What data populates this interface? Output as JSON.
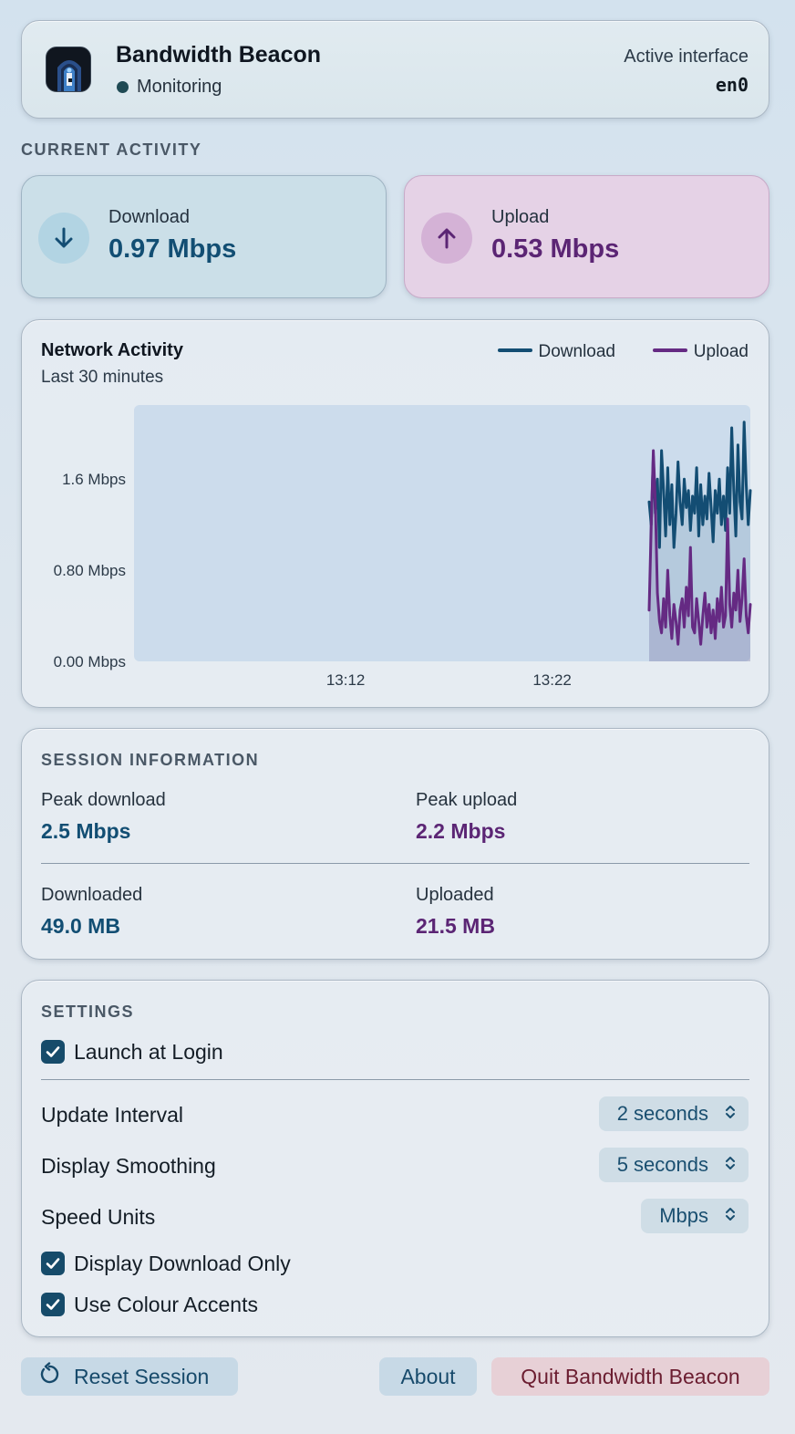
{
  "header": {
    "title": "Bandwidth Beacon",
    "status": "Monitoring",
    "interface_label": "Active interface",
    "interface_value": "en0"
  },
  "current_activity": {
    "caption": "CURRENT ACTIVITY",
    "download": {
      "label": "Download",
      "value": "0.97 Mbps",
      "icon": "arrow-down-icon"
    },
    "upload": {
      "label": "Upload",
      "value": "0.53 Mbps",
      "icon": "arrow-up-icon"
    }
  },
  "chart": {
    "title": "Network Activity",
    "subtitle": "Last 30 minutes",
    "legend": {
      "download": "Download",
      "upload": "Upload"
    }
  },
  "chart_data": {
    "type": "line",
    "title": "Network Activity",
    "subtitle": "Last 30 minutes",
    "xlabel": "",
    "ylabel": "",
    "y_ticks": [
      "0.00 Mbps",
      "0.80 Mbps",
      "1.6 Mbps"
    ],
    "y_tick_values": [
      0,
      0.8,
      1.6
    ],
    "ylim": [
      0,
      2.25
    ],
    "x_ticks": [
      "13:12",
      "13:22"
    ],
    "x_tick_minutes": [
      12,
      22
    ],
    "xlim_minutes": [
      1.75,
      31.6
    ],
    "x_unit": "minutes after 13:00",
    "grid": false,
    "legend_position": "top-right",
    "series": [
      {
        "name": "Download",
        "color": "#134d73",
        "x": [
          26.7,
          26.8,
          26.9,
          27.0,
          27.1,
          27.2,
          27.3,
          27.4,
          27.5,
          27.6,
          27.7,
          27.8,
          27.9,
          28.0,
          28.1,
          28.2,
          28.3,
          28.4,
          28.5,
          28.6,
          28.7,
          28.8,
          28.9,
          29.0,
          29.1,
          29.2,
          29.3,
          29.4,
          29.5,
          29.6,
          29.7,
          29.8,
          29.9,
          30.0,
          30.1,
          30.2,
          30.3,
          30.4,
          30.5,
          30.6,
          30.7,
          30.8,
          30.9,
          31.0,
          31.1,
          31.2,
          31.3,
          31.4,
          31.5,
          31.6
        ],
        "y": [
          1.4,
          1.2,
          1.8,
          1.3,
          1.6,
          1.0,
          1.85,
          1.5,
          1.1,
          1.7,
          1.2,
          1.55,
          1.0,
          1.3,
          1.75,
          1.4,
          1.2,
          1.6,
          1.35,
          1.5,
          1.15,
          1.45,
          1.3,
          1.7,
          1.1,
          1.55,
          1.2,
          1.45,
          1.25,
          1.65,
          1.35,
          1.05,
          1.5,
          1.3,
          1.6,
          1.2,
          1.45,
          1.15,
          1.7,
          1.3,
          2.05,
          1.5,
          1.1,
          1.9,
          1.4,
          1.25,
          2.1,
          1.55,
          1.2,
          1.5
        ]
      },
      {
        "name": "Upload",
        "color": "#652a83",
        "x": [
          26.7,
          26.8,
          26.9,
          27.0,
          27.1,
          27.2,
          27.3,
          27.4,
          27.5,
          27.6,
          27.7,
          27.8,
          27.9,
          28.0,
          28.1,
          28.2,
          28.3,
          28.4,
          28.5,
          28.6,
          28.7,
          28.8,
          28.9,
          29.0,
          29.1,
          29.2,
          29.3,
          29.4,
          29.5,
          29.6,
          29.7,
          29.8,
          29.9,
          30.0,
          30.1,
          30.2,
          30.3,
          30.4,
          30.5,
          30.6,
          30.7,
          30.8,
          30.9,
          31.0,
          31.1,
          31.2,
          31.3,
          31.4,
          31.5,
          31.6
        ],
        "y": [
          0.45,
          1.2,
          1.85,
          1.4,
          0.6,
          0.35,
          0.25,
          0.55,
          0.3,
          0.8,
          0.4,
          0.2,
          0.5,
          0.35,
          0.15,
          0.45,
          0.55,
          0.3,
          0.65,
          0.4,
          1.0,
          0.3,
          0.25,
          0.55,
          0.35,
          0.15,
          0.4,
          0.6,
          0.3,
          0.5,
          0.25,
          0.45,
          0.2,
          0.55,
          0.35,
          0.65,
          0.3,
          0.4,
          1.25,
          0.5,
          0.3,
          0.6,
          0.45,
          0.8,
          0.35,
          0.55,
          0.9,
          0.4,
          0.25,
          0.5
        ]
      }
    ]
  },
  "session": {
    "caption": "SESSION INFORMATION",
    "peak_download_label": "Peak download",
    "peak_download_value": "2.5 Mbps",
    "peak_upload_label": "Peak upload",
    "peak_upload_value": "2.2 Mbps",
    "downloaded_label": "Downloaded",
    "downloaded_value": "49.0 MB",
    "uploaded_label": "Uploaded",
    "uploaded_value": "21.5 MB"
  },
  "settings": {
    "caption": "SETTINGS",
    "launch_at_login": {
      "label": "Launch at Login",
      "checked": true
    },
    "update_interval": {
      "label": "Update Interval",
      "value": "2 seconds"
    },
    "display_smoothing": {
      "label": "Display Smoothing",
      "value": "5 seconds"
    },
    "speed_units": {
      "label": "Speed Units",
      "value": "Mbps"
    },
    "display_download_only": {
      "label": "Display Download Only",
      "checked": true
    },
    "use_colour_accents": {
      "label": "Use Colour Accents",
      "checked": true
    }
  },
  "buttons": {
    "reset": "Reset Session",
    "about": "About",
    "quit": "Quit Bandwidth Beacon"
  },
  "colors": {
    "download": "#134d73",
    "upload": "#652a83",
    "quit": "#6b1d30"
  }
}
